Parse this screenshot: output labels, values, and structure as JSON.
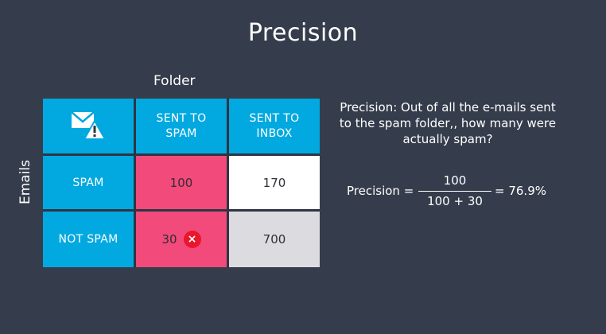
{
  "slide": {
    "title": "Precision",
    "folder_label": "Folder",
    "emails_label": "Emails"
  },
  "matrix": {
    "corner_icon": "mail-warning-icon",
    "col_headers": [
      "SENT TO SPAM",
      "SENT TO INBOX"
    ],
    "rows": [
      {
        "label": "SPAM",
        "values": [
          "100",
          "170"
        ]
      },
      {
        "label": "NOT SPAM",
        "values": [
          "30",
          "700"
        ]
      }
    ],
    "error_marker": "×",
    "colors": {
      "header": "#02a9e0",
      "highlight": "#f24a7b",
      "error": "#e8172c"
    }
  },
  "definition": {
    "text": "Precision: Out of all the e-mails sent to the spam folder,, how many were actually spam?"
  },
  "formula": {
    "label": "Precision =",
    "numerator": "100",
    "denominator": "100 + 30",
    "result": "= 76.9%"
  }
}
